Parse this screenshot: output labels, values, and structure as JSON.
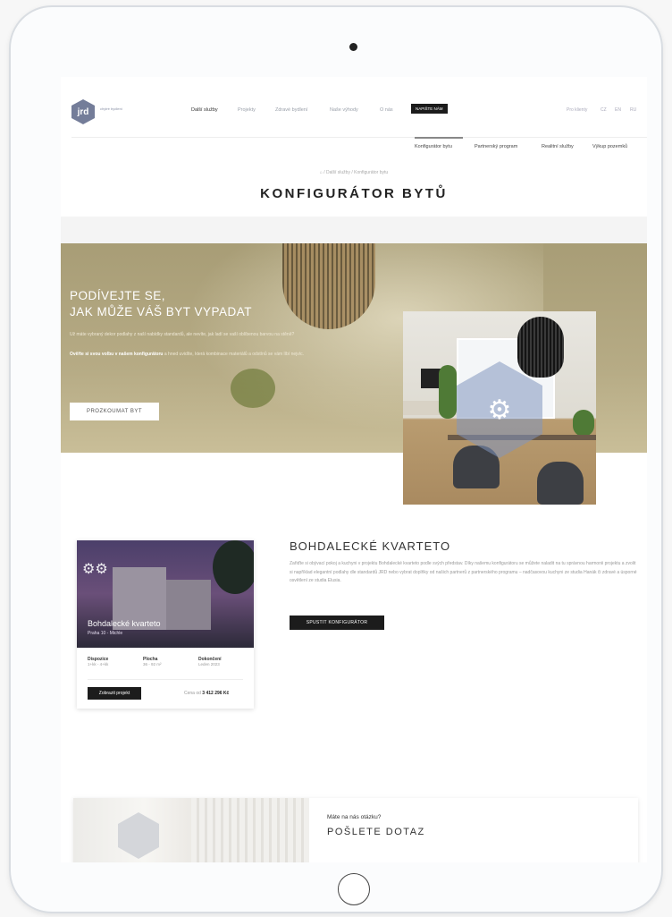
{
  "header": {
    "logo_text": "jrd",
    "logo_tagline": "chytré bydlení",
    "nav": [
      "Další služby",
      "Projekty",
      "Zdravé bydlení",
      "Naše výhody",
      "O nás"
    ],
    "cta": "NAPIŠTE NÁM",
    "lang": [
      "Pro klienty",
      "CZ",
      "EN",
      "RU"
    ]
  },
  "subnav": [
    "Konfigurátor bytu",
    "Partnerský program",
    "Realitní služby",
    "Výkup pozemků"
  ],
  "breadcrumb": "⌂ / Další služby / Konfigurátor bytu",
  "page_title": "KONFIGURÁTOR BYTŮ",
  "hero": {
    "heading_line1": "PODÍVEJTE SE,",
    "heading_line2": "JAK MŮŽE VÁŠ BYT VYPADAT",
    "text1": "Už máte vybraný dekor podlahy z naší nabídky standardů, ale nevíte, jak ladí se vaší oblíbenou barvou na stěně?",
    "text2_bold": "Ověřte si svou volbu v našem konfigurátoru",
    "text2_rest": " a hned uvidíte, která kombinace materiálů a odstínů se vám líbí nejvíc.",
    "button": "PROZKOUMAT BYT"
  },
  "project_card": {
    "name": "Bohdalecké kvarteto",
    "location": "Praha 10 - Michle",
    "specs": [
      {
        "label": "Dispozice",
        "value": "1+kk - 4+kk"
      },
      {
        "label": "Plocha",
        "value": "36 - 92 m²"
      },
      {
        "label": "Dokončení",
        "value": "Leden 2023"
      }
    ],
    "button": "Zobrazit projekt",
    "price_prefix": "Cena od ",
    "price": "3 412 296 Kč"
  },
  "project_detail": {
    "title": "BOHDALECKÉ KVARTETO",
    "text": "Zařiďte si obývací pokoj a kuchyni v projektu Bohdalecké kvarteto podle svých představ. Díky našemu konfigurátoru se můžete naladit na tu správnou harmonii projektu a zvolit si například elegantní podlahy dle standardů JRD nebo vybrat doplňky od našich partnerů z partnerského programu – nadčasovou kuchyni ze studia Hanák či zdravé a úsporné osvětlení ze studia Elusia.",
    "button": "SPUSTIT KONFIGURÁTOR"
  },
  "contact": {
    "question": "Máte na nás otázku?",
    "heading": "POŠLETE DOTAZ"
  },
  "icons": {
    "gear": "gear-icon",
    "home": "home-icon"
  },
  "colors": {
    "accent": "#747d99",
    "hero_bg": "#b0a57e",
    "button_dark": "#1c1c1c"
  }
}
